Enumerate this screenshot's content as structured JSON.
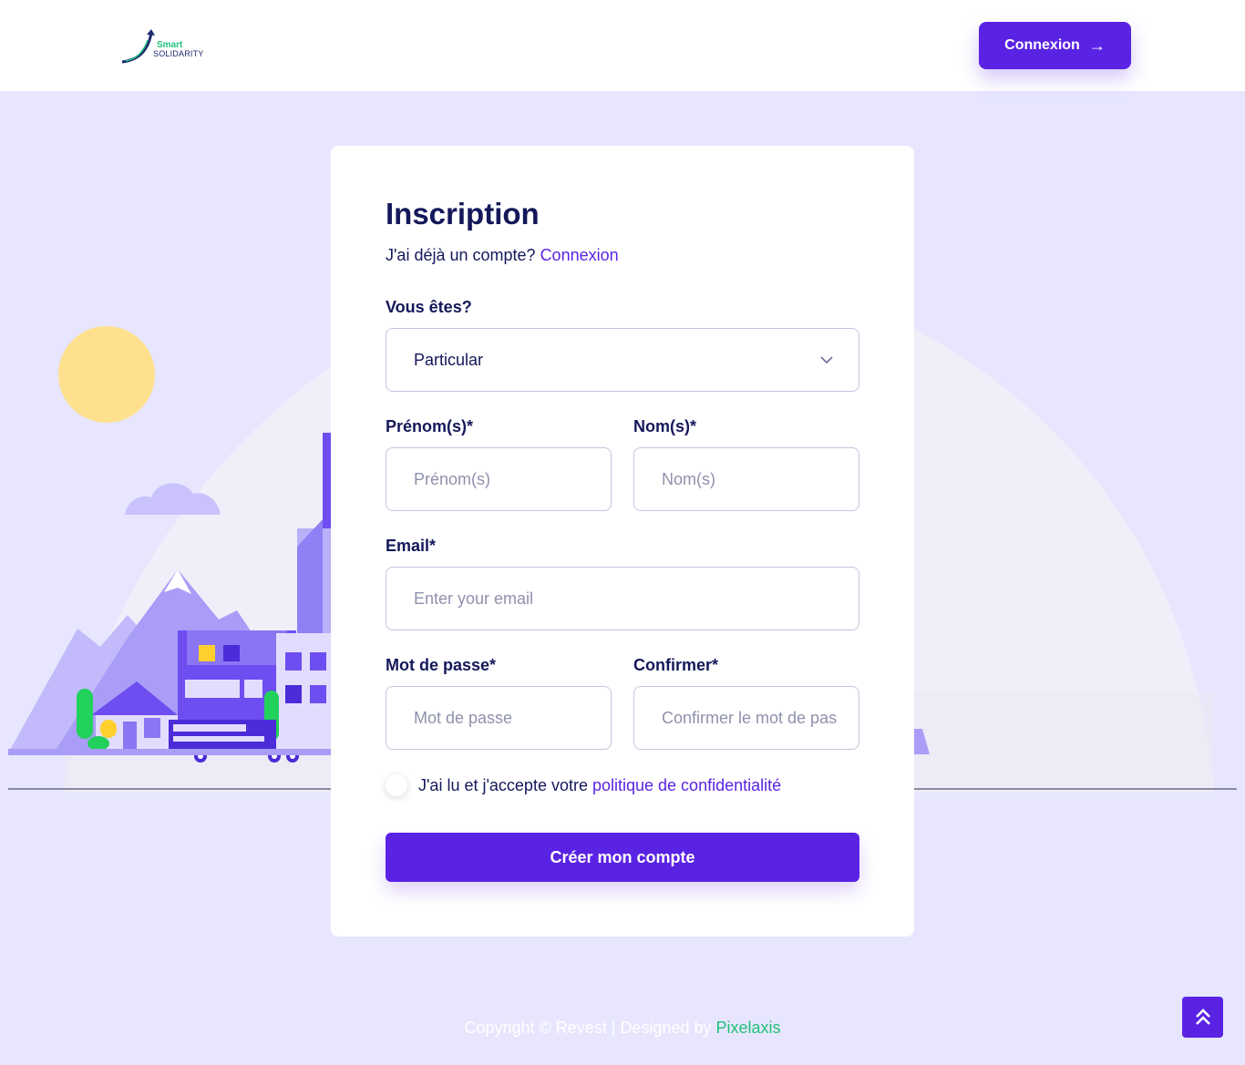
{
  "header": {
    "logo_line1": "Smart",
    "logo_line2": "SOLIDARITY",
    "login_button": "Connexion"
  },
  "form": {
    "title": "Inscription",
    "have_account": "J'ai déjà un compte?",
    "login_link": "Connexion",
    "type_label": "Vous êtes?",
    "type_value": "Particular",
    "firstname_label": "Prénom(s)*",
    "firstname_placeholder": "Prénom(s)",
    "lastname_label": "Nom(s)*",
    "lastname_placeholder": "Nom(s)",
    "email_label": "Email*",
    "email_placeholder": "Enter your email",
    "password_label": "Mot de passe*",
    "password_placeholder": "Mot de passe",
    "confirm_label": "Confirmer*",
    "confirm_placeholder": "Confirmer le mot de pas",
    "terms_text": "J'ai lu et j'accepte votre",
    "terms_link": "politique de confidentialité",
    "submit_label": "Créer mon compte"
  },
  "footer": {
    "copyright": "Copyright © Revest | Designed by",
    "designer": "Pixelaxis"
  },
  "colors": {
    "primary": "#5a23e3",
    "background": "#e7e6fe",
    "text": "#14185a",
    "brand_green": "#22c17a"
  }
}
